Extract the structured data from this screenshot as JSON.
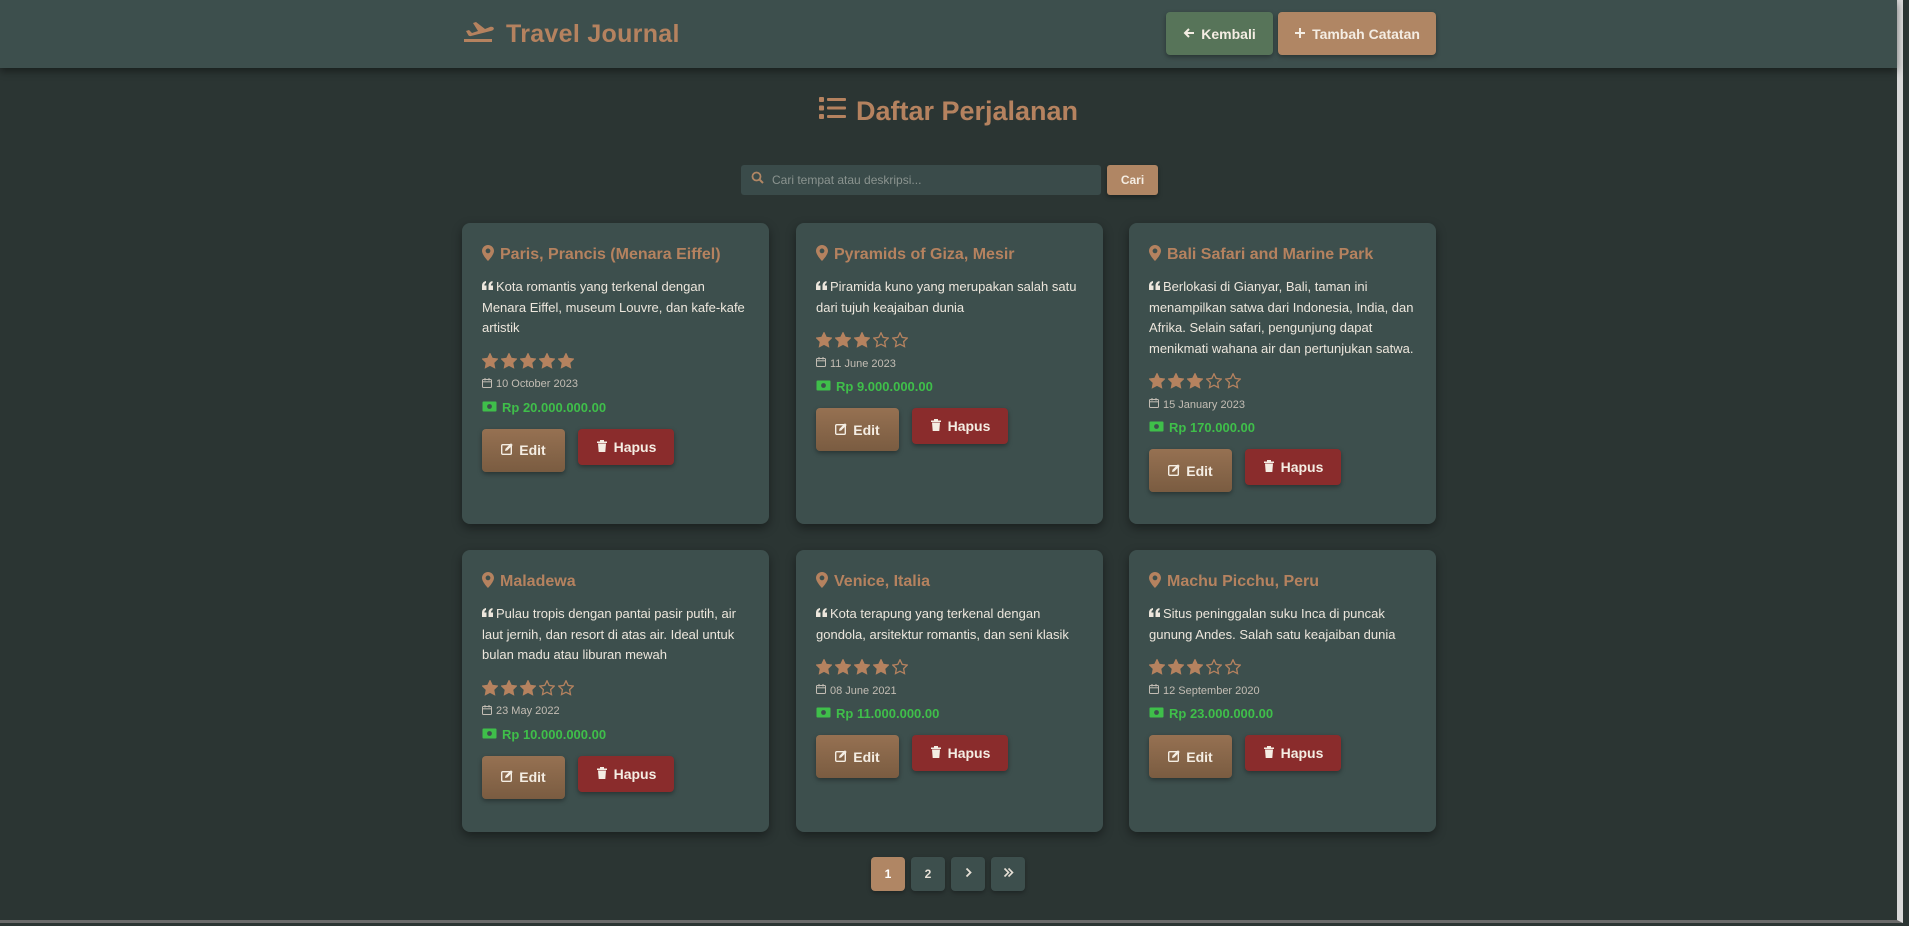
{
  "brand": {
    "title": "Travel Journal",
    "icon": "plane-departure-icon"
  },
  "nav": {
    "back_label": "Kembali",
    "add_label": "Tambah Catatan"
  },
  "heading": {
    "title": "Daftar Perjalanan",
    "icon": "list-icon"
  },
  "search": {
    "placeholder": "Cari tempat atau deskripsi...",
    "value": "",
    "button_label": "Cari"
  },
  "cards": [
    {
      "title": "Paris, Prancis (Menara Eiffel)",
      "description": "Kota romantis yang terkenal dengan Menara Eiffel, museum Louvre, dan kafe-kafe artistik",
      "rating": 5,
      "date": "10 October 2023",
      "price": "Rp 20.000.000.00"
    },
    {
      "title": "Pyramids of Giza, Mesir",
      "description": "Piramida kuno yang merupakan salah satu dari tujuh keajaiban dunia",
      "rating": 3,
      "date": "11 June 2023",
      "price": "Rp 9.000.000.00"
    },
    {
      "title": "Bali Safari and Marine Park",
      "description": "Berlokasi di Gianyar, Bali, taman ini menampilkan satwa dari Indonesia, India, dan Afrika. Selain safari, pengunjung dapat menikmati wahana air dan pertunjukan satwa.",
      "rating": 3,
      "date": "15 January 2023",
      "price": "Rp 170.000.00"
    },
    {
      "title": "Maladewa",
      "description": "Pulau tropis dengan pantai pasir putih, air laut jernih, dan resort di atas air. Ideal untuk bulan madu atau liburan mewah",
      "rating": 3,
      "date": "23 May 2022",
      "price": "Rp 10.000.000.00"
    },
    {
      "title": "Venice, Italia",
      "description": "Kota terapung yang terkenal dengan gondola, arsitektur romantis, dan seni klasik",
      "rating": 4,
      "date": "08 June 2021",
      "price": "Rp 11.000.000.00"
    },
    {
      "title": "Machu Picchu, Peru",
      "description": "Situs peninggalan suku Inca di puncak gunung Andes. Salah satu keajaiban dunia",
      "rating": 3,
      "date": "12 September 2020",
      "price": "Rp 23.000.000.00"
    }
  ],
  "card_actions": {
    "edit_label": "Edit",
    "delete_label": "Hapus"
  },
  "pagination": {
    "pages": [
      "1",
      "2"
    ],
    "current": "1"
  },
  "colors": {
    "accent": "#b5825f",
    "price": "#3fbf4a",
    "delete": "#8a2c2c",
    "back": "#577459"
  }
}
